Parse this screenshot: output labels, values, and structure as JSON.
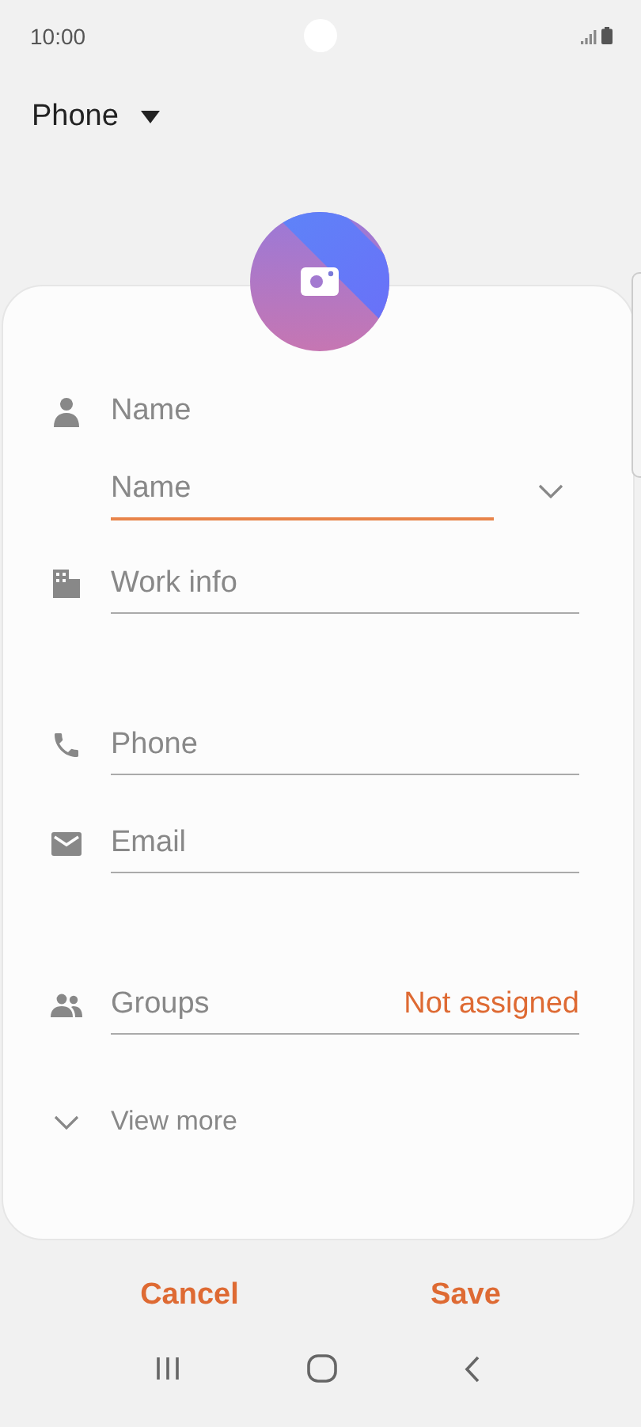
{
  "status_bar": {
    "time": "10:00"
  },
  "storage": {
    "label": "Phone"
  },
  "name_section": {
    "label": "Name",
    "placeholder": "Name",
    "focused": true
  },
  "work_info": {
    "placeholder": "Work info"
  },
  "phone": {
    "placeholder": "Phone"
  },
  "email": {
    "placeholder": "Email"
  },
  "groups": {
    "label": "Groups",
    "value": "Not assigned"
  },
  "view_more": {
    "label": "View more"
  },
  "buttons": [
    {
      "label": "Cancel"
    },
    {
      "label": "Save"
    }
  ]
}
